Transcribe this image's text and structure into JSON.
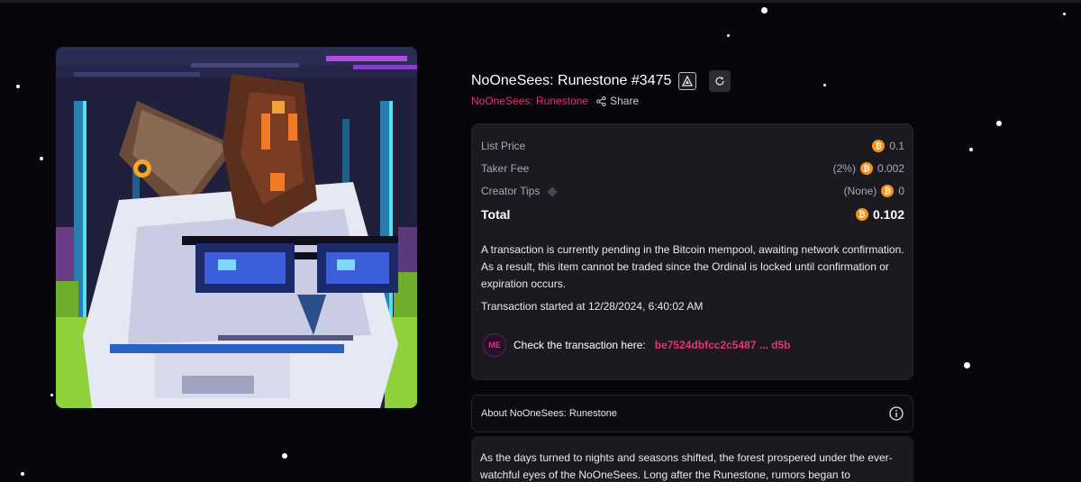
{
  "item": {
    "title": "NoOneSees: Runestone #3475",
    "collection_link": "NoOneSees: Runestone",
    "share_label": "Share"
  },
  "image": {
    "description_icon": "pixel-art-owl-icon"
  },
  "price": {
    "list_price_label": "List Price",
    "list_price_value": "0.1",
    "taker_fee_label": "Taker Fee",
    "taker_fee_pct": "(2%)",
    "taker_fee_value": "0.002",
    "creator_tips_label": "Creator Tips",
    "creator_tips_note": "(None)",
    "creator_tips_value": "0",
    "total_label": "Total",
    "total_value": "0.102",
    "currency_icon": "bitcoin-icon",
    "currency_symbol": "₿"
  },
  "notice": {
    "text": "A transaction is currently pending in the Bitcoin mempool, awaiting network confirmation. As a result, this item cannot be traded since the Ordinal is locked until confirmation or expiration occurs.",
    "started": "Transaction started at 12/28/2024, 6:40:02 AM",
    "check_label": "Check the transaction here:",
    "tx_hash": "be7524dbfcc2c5487 ... d5b",
    "logo_text": "ME"
  },
  "about": {
    "title": "About NoOneSees: Runestone",
    "description": "As the days turned to nights and seasons shifted, the forest prospered under the ever-watchful eyes of the NoOneSees. Long after the Runestone, rumors began to"
  },
  "colors": {
    "background": "#07060b",
    "card": "#1b1a21",
    "accent_pink": "#e5336e",
    "bitcoin_orange": "#f7931a"
  }
}
